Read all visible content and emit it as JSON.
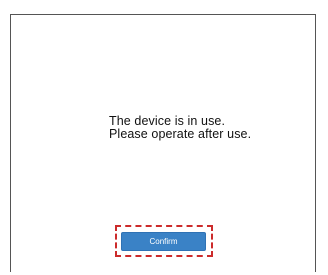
{
  "dialog": {
    "message_line_1": "The device is in use.",
    "message_line_2": "Please operate after use.",
    "confirm_label": "Confirm"
  },
  "colors": {
    "button_bg": "#3a82c6",
    "highlight_border": "#cc2b2b",
    "panel_border": "#555555"
  }
}
